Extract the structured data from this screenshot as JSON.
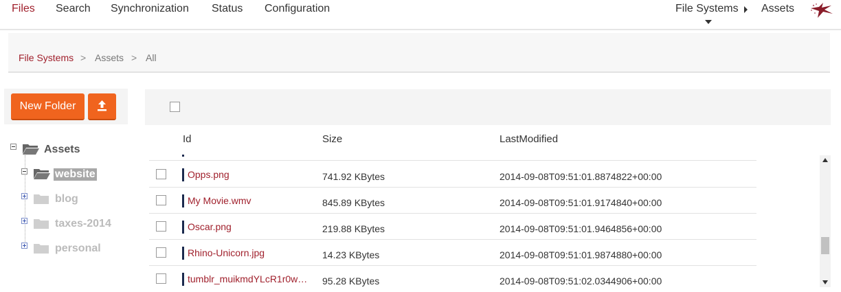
{
  "nav": {
    "items": [
      "Files",
      "Search",
      "Synchronization",
      "Status",
      "Configuration"
    ],
    "right": {
      "filesystems": "File Systems",
      "assets": "Assets"
    },
    "accent": "#a0202c"
  },
  "breadcrumb": {
    "items": [
      "File Systems",
      "Assets",
      "All"
    ],
    "separator": ">"
  },
  "toolbar": {
    "new_folder": "New Folder",
    "upload_icon": "upload-icon"
  },
  "tree": {
    "root": "Assets",
    "children": [
      "website",
      "blog",
      "taxes-2014",
      "personal"
    ],
    "selected": "website"
  },
  "grid": {
    "columns": [
      "Id",
      "Size",
      "LastModified"
    ],
    "rows": [
      {
        "id": "Opps.png",
        "size": "741.92 KBytes",
        "modified": "2014-09-08T09:51:01.8874822+00:00"
      },
      {
        "id": "My Movie.wmv",
        "size": "845.89 KBytes",
        "modified": "2014-09-08T09:51:01.9174840+00:00"
      },
      {
        "id": "Oscar.png",
        "size": "219.88 KBytes",
        "modified": "2014-09-08T09:51:01.9464856+00:00"
      },
      {
        "id": "Rhino-Unicorn.jpg",
        "size": "14.23 KBytes",
        "modified": "2014-09-08T09:51:01.9874880+00:00"
      },
      {
        "id": "tumblr_muikmdYLcR1r0w…",
        "size": "95.28 KBytes",
        "modified": "2014-09-08T09:51:02.0344906+00:00"
      }
    ]
  },
  "colors": {
    "brand": "#a0202c",
    "button": "#f0641e",
    "marker": "#1b2a4e"
  }
}
